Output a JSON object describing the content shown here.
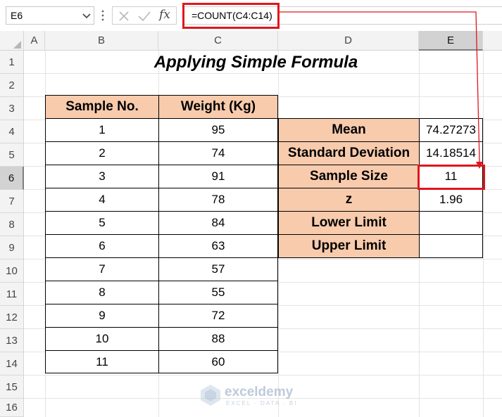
{
  "name_box": {
    "value": "E6"
  },
  "formula_bar": {
    "formula": "=COUNT(C4:C14)",
    "cancel_icon": "x-icon",
    "enter_icon": "check-icon",
    "fx_label": "fx"
  },
  "columns": [
    "A",
    "B",
    "C",
    "D",
    "E"
  ],
  "active_column": "E",
  "rows": [
    "1",
    "2",
    "3",
    "4",
    "5",
    "6",
    "7",
    "8",
    "9",
    "10",
    "11",
    "12",
    "13",
    "14",
    "15",
    "16"
  ],
  "active_row": "6",
  "sheet": {
    "title": "Applying Simple Formula",
    "table_headers": [
      "Sample No.",
      "Weight (Kg)"
    ],
    "samples": [
      {
        "no": "1",
        "weight": "95"
      },
      {
        "no": "2",
        "weight": "74"
      },
      {
        "no": "3",
        "weight": "91"
      },
      {
        "no": "4",
        "weight": "78"
      },
      {
        "no": "5",
        "weight": "84"
      },
      {
        "no": "6",
        "weight": "63"
      },
      {
        "no": "7",
        "weight": "57"
      },
      {
        "no": "8",
        "weight": "55"
      },
      {
        "no": "9",
        "weight": "72"
      },
      {
        "no": "10",
        "weight": "88"
      },
      {
        "no": "11",
        "weight": "60"
      }
    ],
    "stats": [
      {
        "label": "Mean",
        "value": "74.27273"
      },
      {
        "label": "Standard Deviation",
        "value": "14.18514"
      },
      {
        "label": "Sample Size",
        "value": "11"
      },
      {
        "label": "z",
        "value": "1.96"
      },
      {
        "label": "Lower Limit",
        "value": ""
      },
      {
        "label": "Upper Limit",
        "value": ""
      }
    ]
  },
  "watermark": {
    "name": "exceldemy",
    "tagline": "EXCEL · DATA · BI"
  },
  "colors": {
    "header_fill": "#f8cbad",
    "highlight": "#e0161d"
  }
}
